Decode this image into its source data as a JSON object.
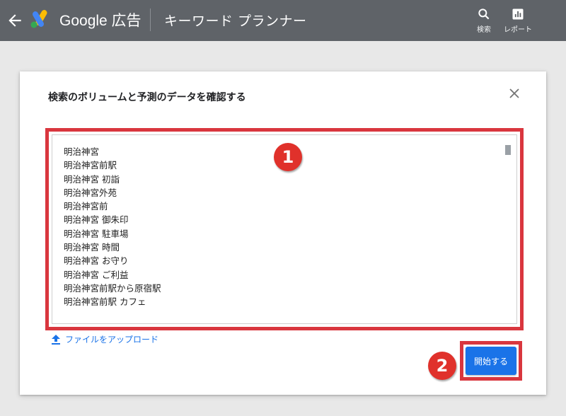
{
  "topbar": {
    "brand": "Google 広告",
    "tool_title": "キーワード プランナー",
    "search_label": "検索",
    "report_label": "レポート",
    "background": "#5f6368"
  },
  "dialog": {
    "title": "検索のボリュームと予測のデータを確認する",
    "keywords": [
      "明治神宮",
      "明治神宮前駅",
      "明治神宮 初詣",
      "明治神宮外苑",
      "明治神宮前",
      "明治神宮 御朱印",
      "明治神宮 駐車場",
      "明治神宮 時間",
      "明治神宮 お守り",
      "明治神宮 ご利益",
      "明治神宮前駅から原宿駅",
      "明治神宮前駅 カフェ"
    ],
    "upload_label": "ファイルをアップロード",
    "start_button": "開始する",
    "annotation_1": "1",
    "annotation_2": "2",
    "accent_color": "#1a73e8",
    "highlight_color": "#d9363e"
  }
}
